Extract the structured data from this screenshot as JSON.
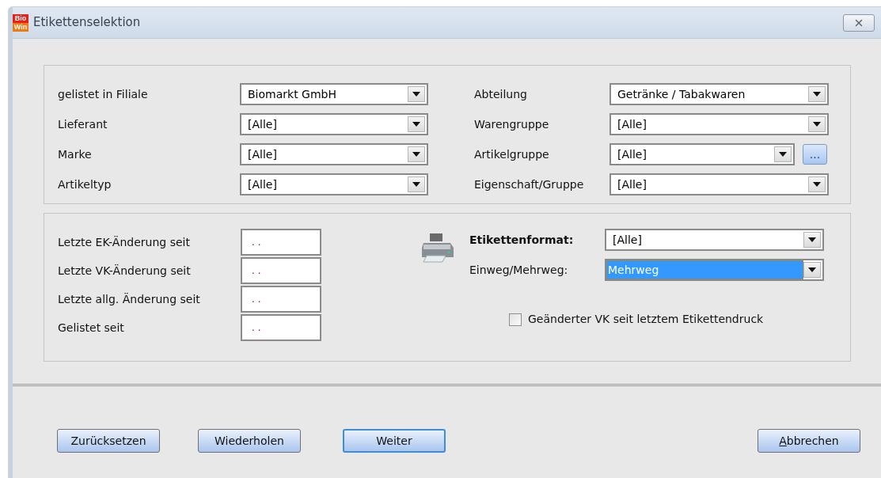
{
  "window": {
    "title": "Etikettenselektion",
    "logo_top": "Bio",
    "logo_bottom": "Win"
  },
  "filters": {
    "left": [
      {
        "label": "gelistet in Filiale",
        "value": "Biomarkt GmbH"
      },
      {
        "label": "Lieferant",
        "value": "[Alle]"
      },
      {
        "label": "Marke",
        "value": "[Alle]"
      },
      {
        "label": "Artikeltyp",
        "value": "[Alle]"
      }
    ],
    "right": [
      {
        "label": "Abteilung",
        "value": "Getränke / Tabakwaren"
      },
      {
        "label": "Warengruppe",
        "value": "[Alle]"
      },
      {
        "label": "Artikelgruppe",
        "value": "[Alle]",
        "browse": "..."
      },
      {
        "label": "Eigenschaft/Gruppe",
        "value": "[Alle]"
      }
    ]
  },
  "dates": [
    {
      "label": "Letzte EK-Änderung seit",
      "value": ". ."
    },
    {
      "label": "Letzte VK-Änderung seit",
      "value": ". ."
    },
    {
      "label": "Letzte allg. Änderung seit",
      "value": ". ."
    },
    {
      "label": "Gelistet seit",
      "value": ". ."
    }
  ],
  "print": [
    {
      "label": "Etikettenformat:",
      "value": "[Alle]",
      "bold": true,
      "selected": false
    },
    {
      "label": "Einweg/Mehrweg:",
      "value": "Mehrweg",
      "bold": false,
      "selected": true
    }
  ],
  "checkbox": {
    "label": "Geänderter VK seit letztem Etikettendruck",
    "checked": false
  },
  "buttons": [
    {
      "label": "Zurücksetzen",
      "default": false,
      "mnemonic": false
    },
    {
      "label": "Wiederholen",
      "default": false,
      "mnemonic": false
    },
    {
      "label": "Weiter",
      "default": true,
      "mnemonic": false
    },
    {
      "label": "Abbrechen",
      "default": false,
      "mnemonic": true
    }
  ]
}
